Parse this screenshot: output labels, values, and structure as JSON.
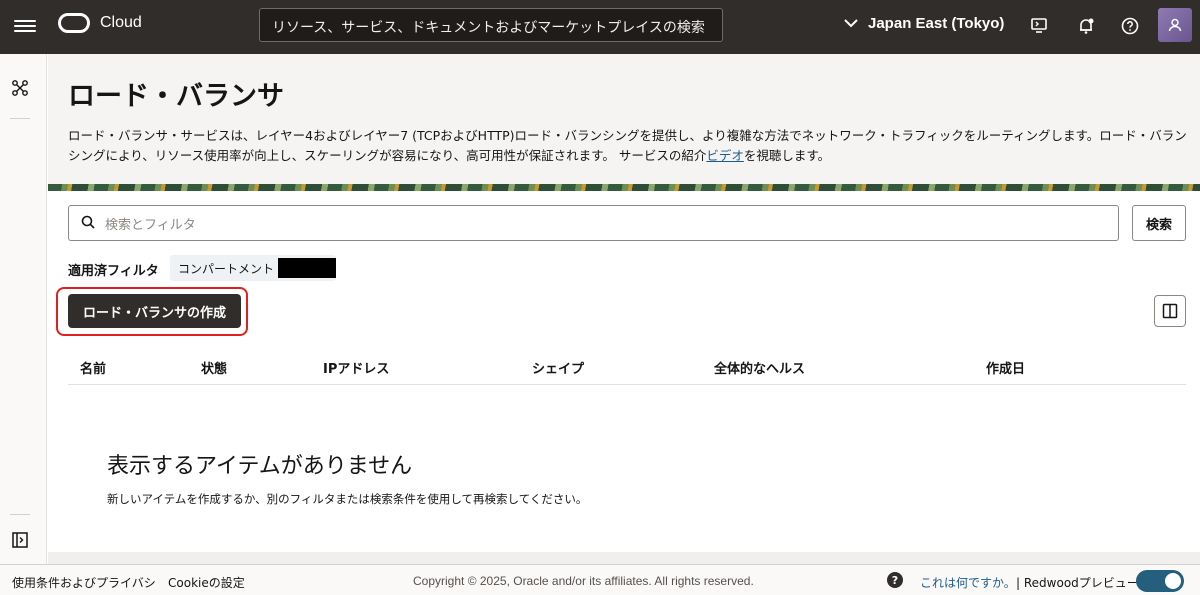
{
  "topbar": {
    "brand": "Cloud",
    "search_placeholder": "リソース、サービス、ドキュメントおよびマーケットプレイスの検索",
    "region": "Japan East (Tokyo)"
  },
  "page": {
    "title": "ロード・バランサ",
    "description": "ロード・バランサ・サービスは、レイヤー4およびレイヤー7 (TCPおよびHTTP)ロード・バランシングを提供し、より複雑な方法でネットワーク・トラフィックをルーティングします。ロード・バランシングにより、リソース使用率が向上し、スケーリングが容易になり、高可用性が保証されます。 サービスの紹介",
    "description_link": "ビデオ",
    "description_tail": "を視聴します。"
  },
  "filters": {
    "placeholder": "検索とフィルタ",
    "search_button": "検索",
    "applied_label": "適用済フィルタ",
    "chip_label": "コンパートメント"
  },
  "actions": {
    "create_button": "ロード・バランサの作成"
  },
  "table": {
    "columns": [
      "名前",
      "状態",
      "IPアドレス",
      "シェイプ",
      "全体的なヘルス",
      "作成日"
    ]
  },
  "empty_state": {
    "title": "表示するアイテムがありません",
    "description": "新しいアイテムを作成するか、別のフィルタまたは検索条件を使用して再検索してください。"
  },
  "footer": {
    "terms": "使用条件およびプライバシ",
    "cookie": "Cookieの設定",
    "copyright": "Copyright © 2025, Oracle and/or its affiliates. All rights reserved.",
    "whats_this": "これは何ですか。",
    "redwood": "| Redwoodプレビュー"
  },
  "icons": {
    "menu": "hamburger-icon",
    "search": "search-icon",
    "region_chevron": "chevron-down-icon",
    "cloud_shell": "cloud-shell-icon",
    "notifications": "bell-icon",
    "help": "help-icon",
    "profile": "user-icon",
    "rail_network": "network-nodes-icon",
    "rail_collapse": "panel-toggle-icon",
    "columns": "columns-icon"
  }
}
